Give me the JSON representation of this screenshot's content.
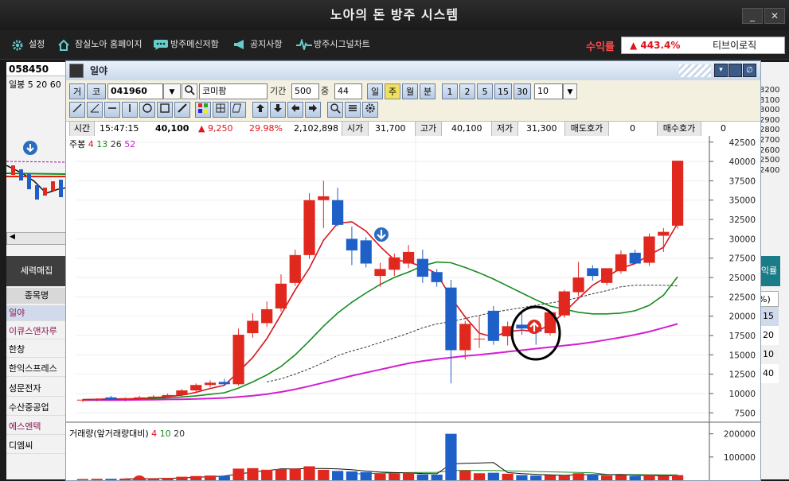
{
  "window": {
    "title": "노아의 돈 방주 시스템",
    "minimize_label": "_",
    "close_label": "✕"
  },
  "toolbar": {
    "items": [
      {
        "label": "설정",
        "icon": "gear-icon"
      },
      {
        "label": "잠실노아 홈페이지",
        "icon": "home-icon"
      },
      {
        "label": "방주메신저함",
        "icon": "messenger-icon"
      },
      {
        "label": "공지사항",
        "icon": "megaphone-icon"
      },
      {
        "label": "방주시그널차트",
        "icon": "signal-chart-icon"
      }
    ],
    "profit_label": "수익률",
    "profit_value": "▲ 443.4%",
    "profit_account": "티브이로직"
  },
  "left_panel": {
    "code": "058450",
    "candle_info": "일봉 5 20 60",
    "tab_label": "세력매집",
    "list_header": "종목명",
    "stocks": [
      "일야",
      "이큐스앤자루",
      "한창",
      "한익스프레스",
      "성문전자",
      "수산중공업",
      "에스엔텍",
      "디엠씨"
    ]
  },
  "right_panel": {
    "axis": [
      "3200",
      "3100",
      "3000",
      "2900",
      "2800",
      "2700",
      "2600",
      "2500",
      "2400"
    ],
    "tab_label": "익률",
    "pct_label": "%)",
    "pct_values": [
      "15",
      "20",
      "10",
      "40"
    ]
  },
  "chart_window": {
    "title": "일야",
    "controls": {
      "btn_ge": "거",
      "btn_ko": "코",
      "code": "041960",
      "name": "코미팜",
      "period_label": "기간",
      "period": "500",
      "jung_label": "중",
      "jung_value": "44",
      "periods": [
        "일",
        "주",
        "월",
        "분"
      ],
      "minutes": [
        "1",
        "2",
        "5",
        "15",
        "30"
      ],
      "minute_value": "10"
    },
    "info": {
      "time_label": "시간",
      "time": "15:47:15",
      "price": "40,100",
      "change": "▲ 9,250",
      "change_pct": "29.98%",
      "volume": "2,102,898",
      "open_label": "시가",
      "open": "31,700",
      "high_label": "고가",
      "high": "40,100",
      "low_label": "저가",
      "low": "31,300",
      "ask_label": "매도호가",
      "ask": "0",
      "bid_label": "매수호가",
      "bid": "0"
    },
    "price_legend": {
      "label": "주봉",
      "ma1": "4",
      "ma2": "13",
      "ma3": "26",
      "ma4": "52"
    },
    "volume_legend": {
      "label": "거래량(앞거래량대비)",
      "ma1": "4",
      "ma2": "10",
      "ma3": "20"
    }
  },
  "colors": {
    "up": "#e0281e",
    "down": "#1f5fc8",
    "ma4": "#d8141e",
    "ma13": "#168c1e",
    "ma26": "#333333",
    "ma52": "#d21ed2"
  },
  "chart_data": [
    {
      "type": "candlestick",
      "title": "",
      "y_ticks": [
        42500,
        40000,
        37500,
        35000,
        32500,
        30000,
        27500,
        25000,
        22500,
        20000,
        17500,
        15000,
        12500,
        10000,
        7500
      ],
      "ylim": [
        6500,
        43300
      ],
      "candles": [
        {
          "o": 9100,
          "h": 9300,
          "l": 8900,
          "c": 9200
        },
        {
          "o": 9200,
          "h": 9400,
          "l": 9000,
          "c": 9300
        },
        {
          "o": 9500,
          "h": 9700,
          "l": 9100,
          "c": 9200
        },
        {
          "o": 9200,
          "h": 9500,
          "l": 9000,
          "c": 9400
        },
        {
          "o": 9400,
          "h": 9700,
          "l": 9200,
          "c": 9500
        },
        {
          "o": 9500,
          "h": 9800,
          "l": 9300,
          "c": 9600
        },
        {
          "o": 9600,
          "h": 10000,
          "l": 9400,
          "c": 9800
        },
        {
          "o": 9800,
          "h": 10600,
          "l": 9600,
          "c": 10400
        },
        {
          "o": 10400,
          "h": 11300,
          "l": 10100,
          "c": 11100
        },
        {
          "o": 11100,
          "h": 11700,
          "l": 10800,
          "c": 11400
        },
        {
          "o": 11500,
          "h": 11900,
          "l": 11000,
          "c": 11200
        },
        {
          "o": 11200,
          "h": 18400,
          "l": 11000,
          "c": 17600
        },
        {
          "o": 17800,
          "h": 20400,
          "l": 17200,
          "c": 19400
        },
        {
          "o": 19100,
          "h": 21900,
          "l": 18600,
          "c": 20900
        },
        {
          "o": 21000,
          "h": 25400,
          "l": 20600,
          "c": 24200
        },
        {
          "o": 24300,
          "h": 28600,
          "l": 23900,
          "c": 27900
        },
        {
          "o": 27900,
          "h": 35900,
          "l": 27400,
          "c": 35000
        },
        {
          "o": 35000,
          "h": 37500,
          "l": 31400,
          "c": 35500
        },
        {
          "o": 35000,
          "h": 36600,
          "l": 31600,
          "c": 31800
        },
        {
          "o": 30000,
          "h": 31600,
          "l": 26600,
          "c": 28500
        },
        {
          "o": 29800,
          "h": 30200,
          "l": 26300,
          "c": 26800
        },
        {
          "o": 25200,
          "h": 26900,
          "l": 23800,
          "c": 26100
        },
        {
          "o": 26000,
          "h": 28100,
          "l": 25200,
          "c": 27600
        },
        {
          "o": 26800,
          "h": 29200,
          "l": 26200,
          "c": 28300
        },
        {
          "o": 27400,
          "h": 28600,
          "l": 24300,
          "c": 25100
        },
        {
          "o": 25700,
          "h": 26100,
          "l": 23800,
          "c": 24400
        },
        {
          "o": 23700,
          "h": 24700,
          "l": 11300,
          "c": 15600
        },
        {
          "o": 15600,
          "h": 19400,
          "l": 14400,
          "c": 19000
        },
        {
          "o": 17000,
          "h": 20000,
          "l": 15900,
          "c": 17100
        },
        {
          "o": 20700,
          "h": 21300,
          "l": 16300,
          "c": 16800
        },
        {
          "o": 17400,
          "h": 19300,
          "l": 16200,
          "c": 18700
        },
        {
          "o": 18900,
          "h": 20600,
          "l": 17600,
          "c": 18400
        },
        {
          "o": 18600,
          "h": 19200,
          "l": 16300,
          "c": 18000
        },
        {
          "o": 17800,
          "h": 20400,
          "l": 17500,
          "c": 20500
        },
        {
          "o": 20100,
          "h": 23400,
          "l": 19800,
          "c": 23200
        },
        {
          "o": 23100,
          "h": 27000,
          "l": 22600,
          "c": 25000
        },
        {
          "o": 26200,
          "h": 26600,
          "l": 24600,
          "c": 25200
        },
        {
          "o": 24300,
          "h": 26200,
          "l": 24000,
          "c": 26200
        },
        {
          "o": 25800,
          "h": 28500,
          "l": 25500,
          "c": 28000
        },
        {
          "o": 28200,
          "h": 28600,
          "l": 26800,
          "c": 26800
        },
        {
          "o": 26900,
          "h": 30700,
          "l": 26500,
          "c": 30300
        },
        {
          "o": 30400,
          "h": 31400,
          "l": 28300,
          "c": 30900
        },
        {
          "o": 31700,
          "h": 40100,
          "l": 31300,
          "c": 40100
        }
      ],
      "ma4": [
        9200,
        9250,
        9300,
        9300,
        9350,
        9450,
        9600,
        9800,
        10150,
        10650,
        11050,
        12800,
        14650,
        17100,
        20200,
        23400,
        26200,
        29800,
        32000,
        32200,
        31000,
        29000,
        27300,
        27000,
        26400,
        25500,
        22400,
        19900,
        17800,
        17300,
        18000,
        18200,
        18000,
        18900,
        20500,
        22300,
        24000,
        25100,
        26200,
        26800,
        27900,
        28900,
        32000
      ],
      "ma13": [
        9200,
        9230,
        9250,
        9260,
        9300,
        9350,
        9430,
        9550,
        9700,
        9900,
        10100,
        10700,
        11500,
        12400,
        13500,
        15000,
        16800,
        18700,
        20400,
        21800,
        23000,
        24100,
        25000,
        25700,
        26500,
        27000,
        26900,
        26300,
        25600,
        24800,
        23900,
        23000,
        22100,
        21300,
        20900,
        20500,
        20300,
        20300,
        20400,
        20700,
        21400,
        22700,
        25100
      ],
      "ma26": [
        null,
        null,
        null,
        null,
        null,
        null,
        null,
        null,
        null,
        null,
        null,
        null,
        null,
        11500,
        11900,
        12500,
        13200,
        14000,
        14900,
        15500,
        16000,
        16600,
        17200,
        17800,
        18500,
        19000,
        19300,
        19700,
        20100,
        20500,
        20800,
        21100,
        21400,
        21700,
        22000,
        22400,
        22900,
        23300,
        23800,
        24000,
        24000,
        24000,
        23900
      ],
      "ma52": [
        9150,
        9150,
        9150,
        9160,
        9180,
        9200,
        9230,
        9260,
        9300,
        9360,
        9430,
        9560,
        9720,
        9920,
        10200,
        10550,
        10950,
        11400,
        11850,
        12300,
        12700,
        13100,
        13500,
        13900,
        14200,
        14450,
        14650,
        14850,
        15000,
        15200,
        15400,
        15600,
        15800,
        16000,
        16200,
        16400,
        16650,
        16950,
        17250,
        17600,
        18000,
        18500,
        19000
      ]
    },
    {
      "type": "bar",
      "title": "",
      "y_ticks": [
        200000,
        100000
      ],
      "ylim": [
        0,
        240000
      ],
      "values": [
        5000,
        6000,
        6000,
        7000,
        7000,
        8000,
        10000,
        15000,
        18000,
        20000,
        18000,
        50000,
        52000,
        45000,
        48000,
        50000,
        60000,
        45000,
        40000,
        38000,
        35000,
        28000,
        30000,
        32000,
        25000,
        24000,
        200000,
        42000,
        30000,
        32000,
        28000,
        22000,
        20000,
        22000,
        20000,
        30000,
        25000,
        20000,
        22000,
        18000,
        22000,
        18000,
        22000
      ],
      "ma4": [
        null,
        null,
        null,
        6000,
        6500,
        7000,
        8000,
        10000,
        12750,
        15250,
        17750,
        26500,
        35000,
        41250,
        48750,
        48750,
        50750,
        50750,
        48750,
        45750,
        39500,
        35250,
        32750,
        31250,
        28750,
        27750,
        70250,
        72750,
        74000,
        76000,
        33000,
        28000,
        25500,
        23000,
        21000,
        23000,
        24250,
        23750,
        24250,
        21250,
        20500,
        20000,
        20000
      ],
      "ma20": [
        null,
        null,
        null,
        null,
        null,
        null,
        null,
        null,
        null,
        null,
        null,
        null,
        null,
        null,
        null,
        null,
        null,
        null,
        null,
        27000,
        28500,
        30000,
        31500,
        33000,
        33500,
        34000,
        42000,
        42500,
        42000,
        41500,
        40500,
        39000,
        37500,
        36000,
        34500,
        33500,
        32000,
        25000,
        24500,
        24000,
        23500,
        23000,
        23000
      ]
    }
  ]
}
